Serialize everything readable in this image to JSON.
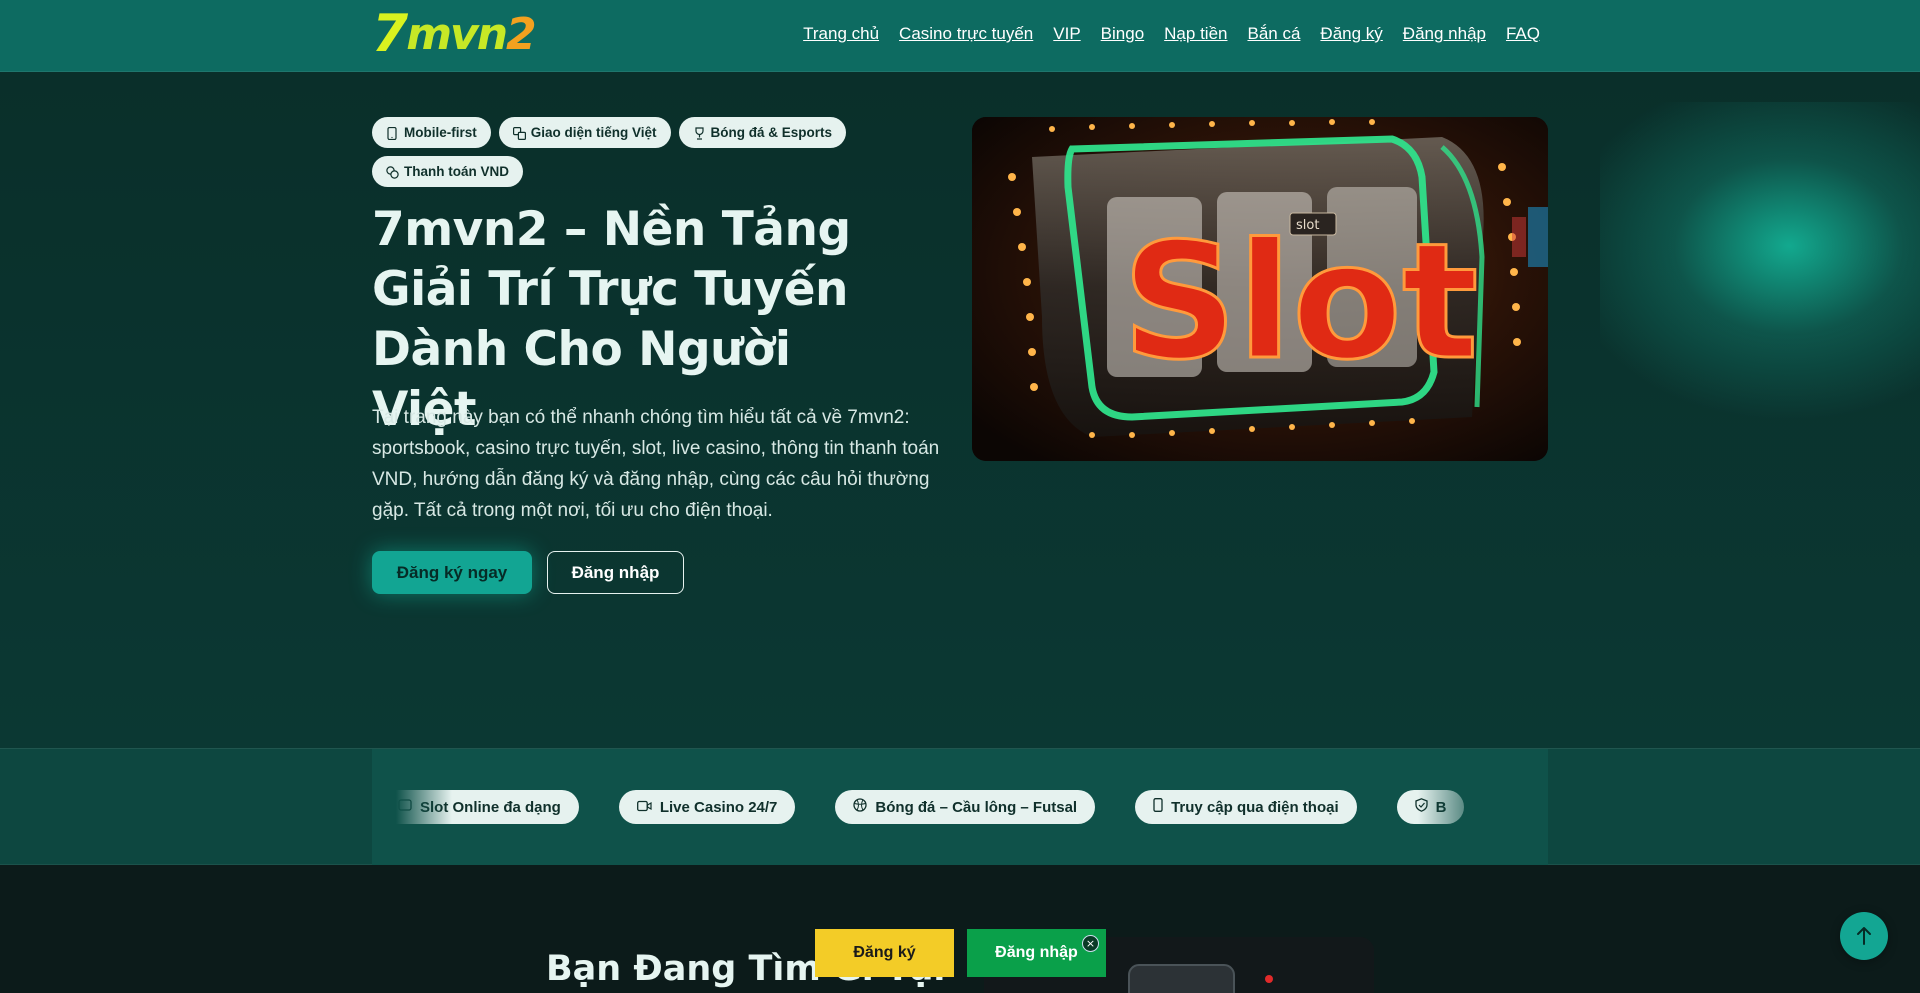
{
  "header": {
    "logo": {
      "seven": "7",
      "m": "mvn",
      "two": "2"
    },
    "nav": [
      "Trang chủ",
      "Casino trực tuyến",
      "VIP",
      "Bingo",
      "Nạp tiền",
      "Bắn cá",
      "Đăng ký",
      "Đăng nhập",
      "FAQ"
    ]
  },
  "hero": {
    "tags": [
      {
        "icon": "phone-icon",
        "label": "Mobile-first"
      },
      {
        "icon": "translate-icon",
        "label": "Giao diện tiếng Việt"
      },
      {
        "icon": "trophy-icon",
        "label": "Bóng đá & Esports"
      },
      {
        "icon": "coins-icon",
        "label": "Thanh toán VND"
      }
    ],
    "title": "7mvn2 – Nền Tảng Giải Trí Trực Tuyến Dành Cho Người Việt",
    "description": "Tại trang này bạn có thể nhanh chóng tìm hiểu tất cả về 7mvn2: sportsbook, casino trực tuyến, slot, live casino, thông tin thanh toán VND, hướng dẫn đăng ký và đăng nhập, cùng các câu hỏi thường gặp. Tất cả trong một nơi, tối ưu cho điện thoại.",
    "primary_button": "Đăng ký ngay",
    "secondary_button": "Đăng nhập",
    "image_sign": "Slot",
    "image_small_sign": "slot"
  },
  "features": [
    {
      "icon": "slot-icon",
      "label": "Slot Online đa dạng"
    },
    {
      "icon": "video-icon",
      "label": "Live Casino 24/7"
    },
    {
      "icon": "ball-icon",
      "label": "Bóng đá – Cầu lông – Futsal"
    },
    {
      "icon": "phone-icon",
      "label": "Truy cập qua điện thoại"
    },
    {
      "icon": "shield-icon",
      "label": "B"
    }
  ],
  "section": {
    "title": "Bạn Đang Tìm Gì Tại"
  },
  "floating": {
    "register": "Đăng ký",
    "login": "Đăng nhập",
    "close": "×"
  },
  "colors": {
    "header": "#0d6b61",
    "accent": "#12a593",
    "register_cta": "#f3cc27",
    "login_cta": "#0aa04a"
  }
}
